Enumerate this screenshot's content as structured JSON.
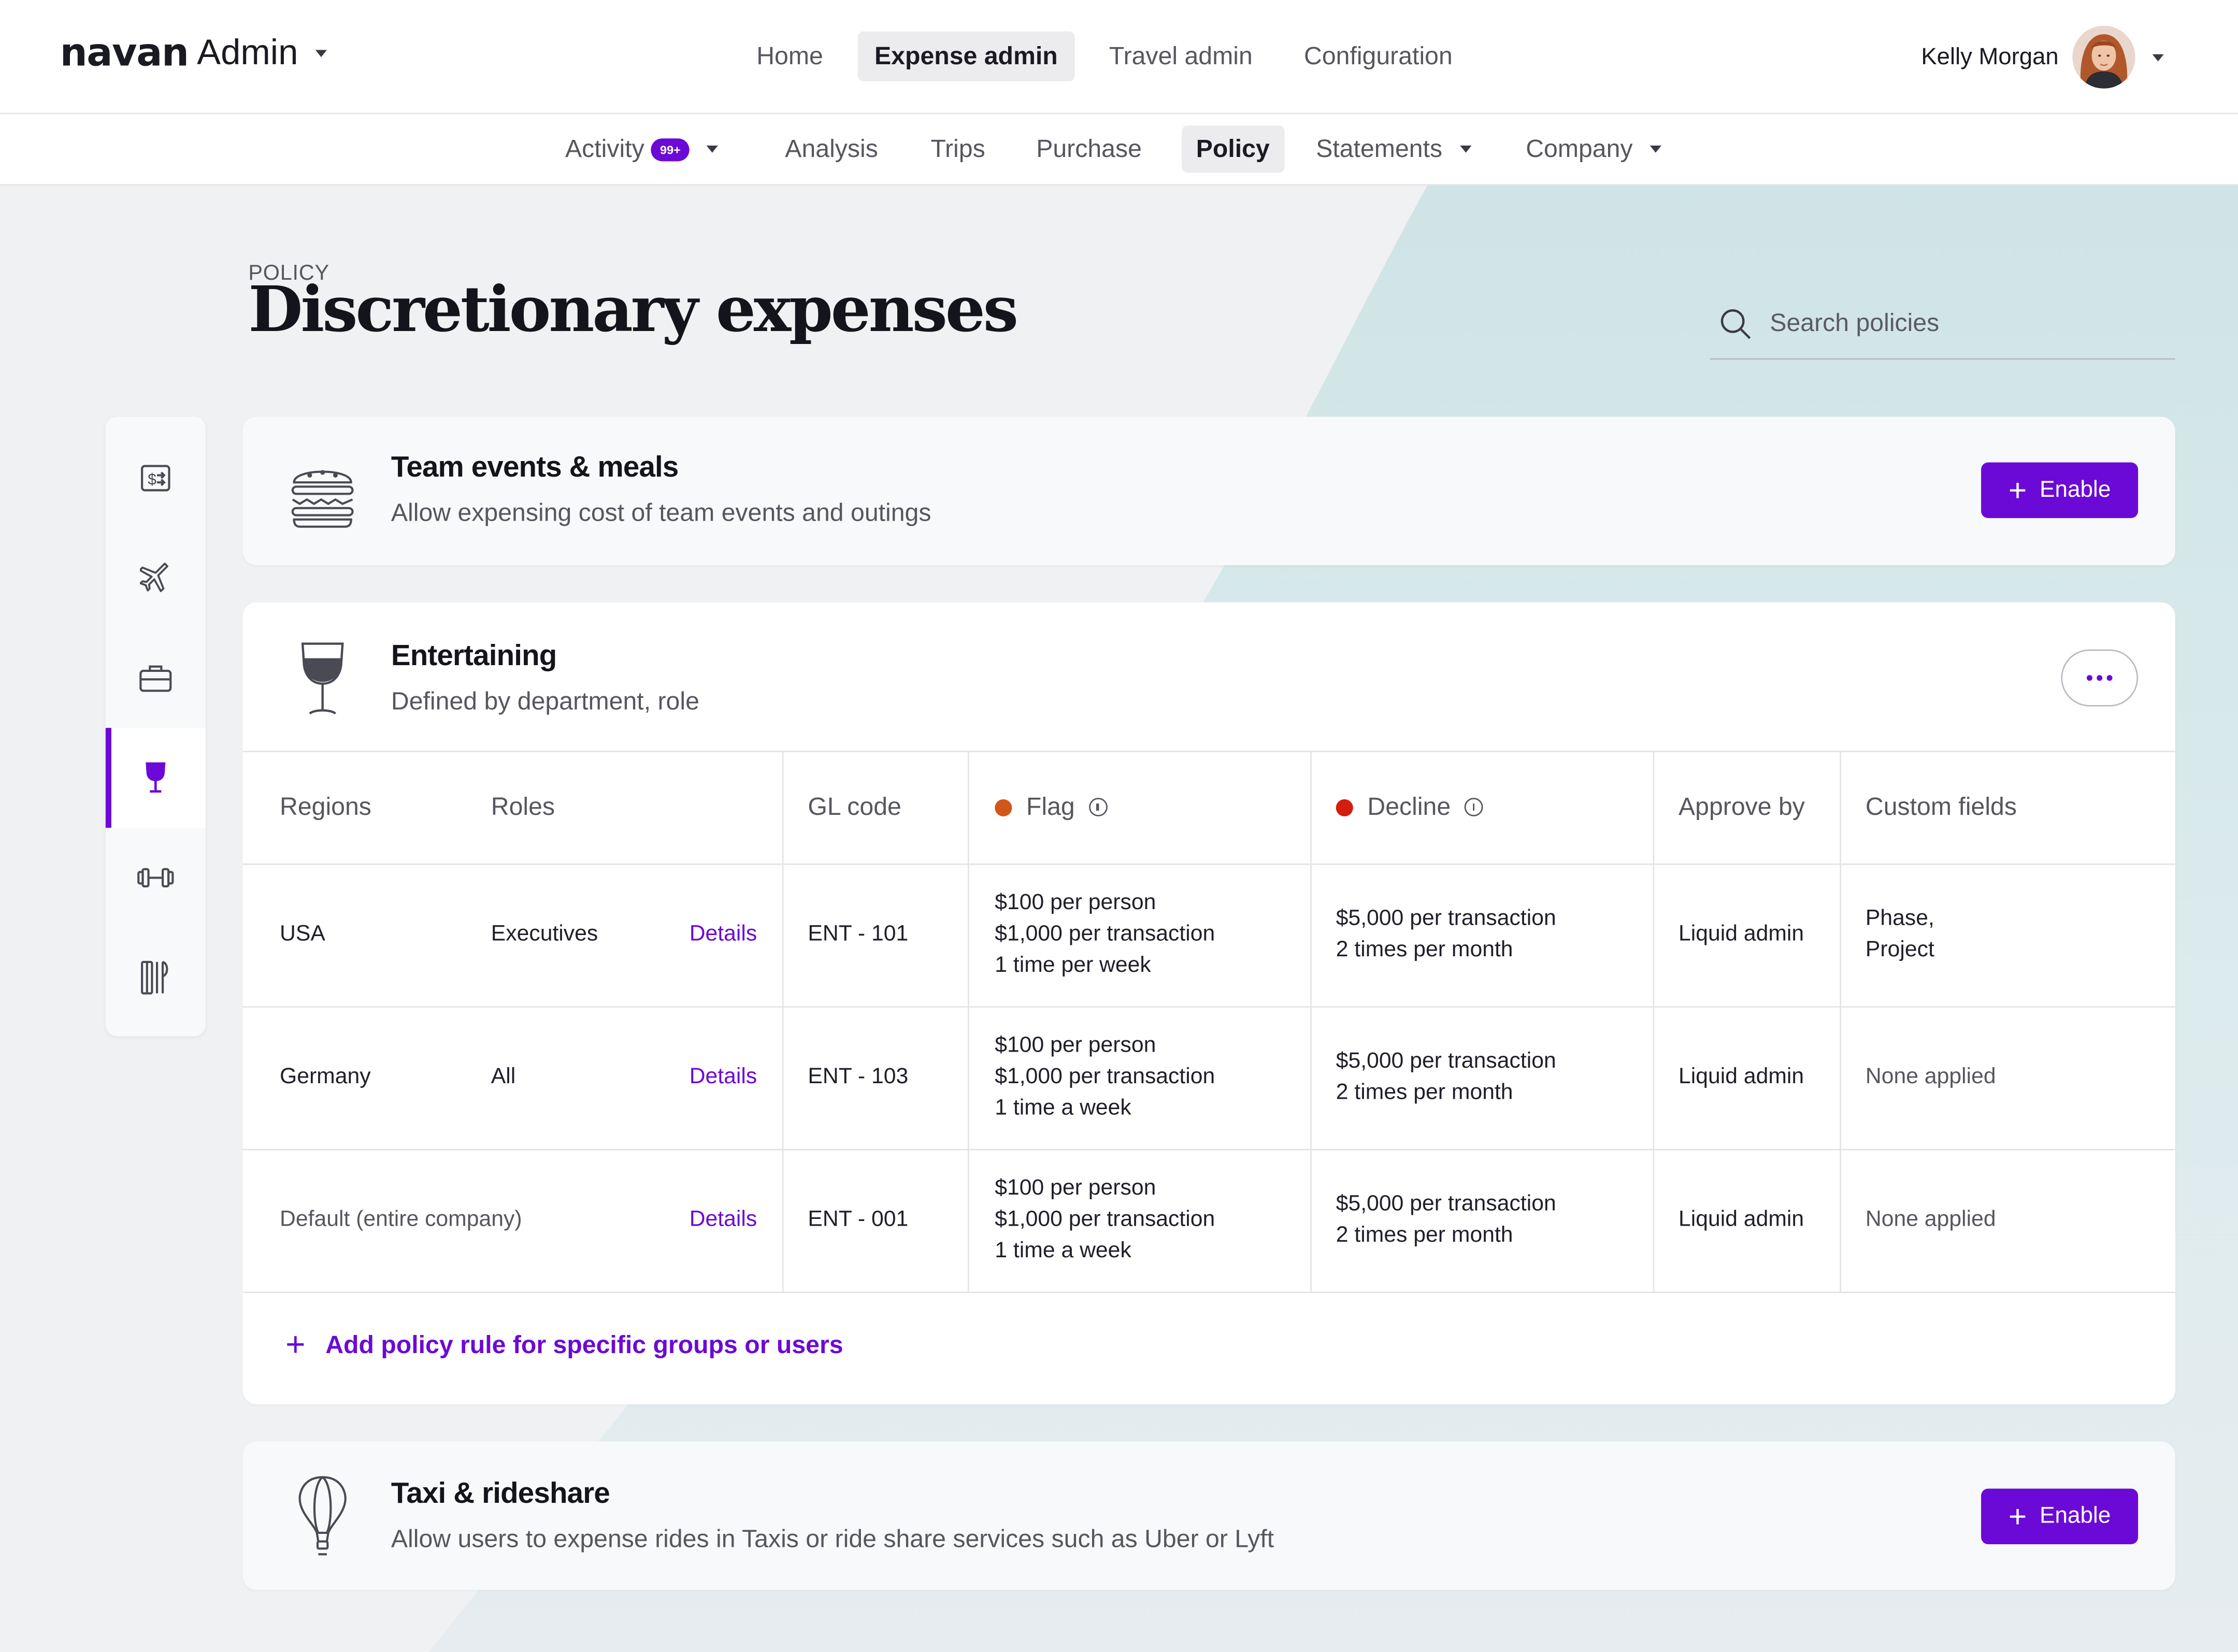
{
  "header": {
    "brand_logo": "navan",
    "brand_sub": "Admin",
    "nav": [
      {
        "label": "Home",
        "active": false
      },
      {
        "label": "Expense admin",
        "active": true
      },
      {
        "label": "Travel admin",
        "active": false
      },
      {
        "label": "Configuration",
        "active": false
      }
    ],
    "user_name": "Kelly Morgan"
  },
  "subnav": {
    "activity": "Activity",
    "activity_badge": "99+",
    "analysis": "Analysis",
    "trips": "Trips",
    "purchase": "Purchase",
    "policy": "Policy",
    "statements": "Statements",
    "company": "Company"
  },
  "page": {
    "eyebrow": "POLICY",
    "title": "Discretionary expenses",
    "search_placeholder": "Search policies"
  },
  "rail_icons": [
    "money-exchange-icon",
    "airplane-icon",
    "briefcase-icon",
    "wine-glass-icon",
    "dumbbell-icon",
    "utensils-icon"
  ],
  "cards": {
    "team": {
      "title": "Team events & meals",
      "desc": "Allow expensing cost of team events and outings",
      "button": "Enable",
      "icon": "burger-icon"
    },
    "entertaining": {
      "title": "Entertaining",
      "desc": "Defined by department, role",
      "icon": "wine-glass-icon"
    },
    "taxi": {
      "title": "Taxi & rideshare",
      "desc": "Allow users to expense rides in Taxis or ride share services such as Uber or Lyft",
      "button": "Enable",
      "icon": "hot-air-balloon-icon"
    }
  },
  "table": {
    "headers": {
      "regions": "Regions",
      "roles": "Roles",
      "gl_code": "GL code",
      "flag": "Flag",
      "decline": "Decline",
      "approve_by": "Approve by",
      "custom_fields": "Custom fields"
    },
    "colors": {
      "flag": "#d2561a",
      "decline": "#d41c0f",
      "accent": "#6b0ad6"
    },
    "rows": [
      {
        "region": "USA",
        "role": "Executives",
        "details": "Details",
        "gl": "ENT - 101",
        "flag": [
          "$100 per person",
          "$1,000 per transaction",
          "1 time per week"
        ],
        "decline": [
          "$5,000 per transaction",
          "2 times per month"
        ],
        "approve": "Liquid admin",
        "custom": [
          "Phase,",
          "Project"
        ]
      },
      {
        "region": "Germany",
        "role": "All",
        "details": "Details",
        "gl": "ENT - 103",
        "flag": [
          "$100 per person",
          "$1,000 per transaction",
          "1 time a week"
        ],
        "decline": [
          "$5,000 per transaction",
          "2 times per month"
        ],
        "approve": "Liquid admin",
        "custom": [
          "None applied"
        ]
      },
      {
        "region": "Default (entire company)",
        "role": "",
        "details": "Details",
        "gl": "ENT - 001",
        "flag": [
          "$100 per person",
          "$1,000 per transaction",
          "1 time a week"
        ],
        "decline": [
          "$5,000 per transaction",
          "2 times per month"
        ],
        "approve": "Liquid admin",
        "custom": [
          "None applied"
        ]
      }
    ],
    "add_rule": "Add policy rule for specific groups or users"
  }
}
